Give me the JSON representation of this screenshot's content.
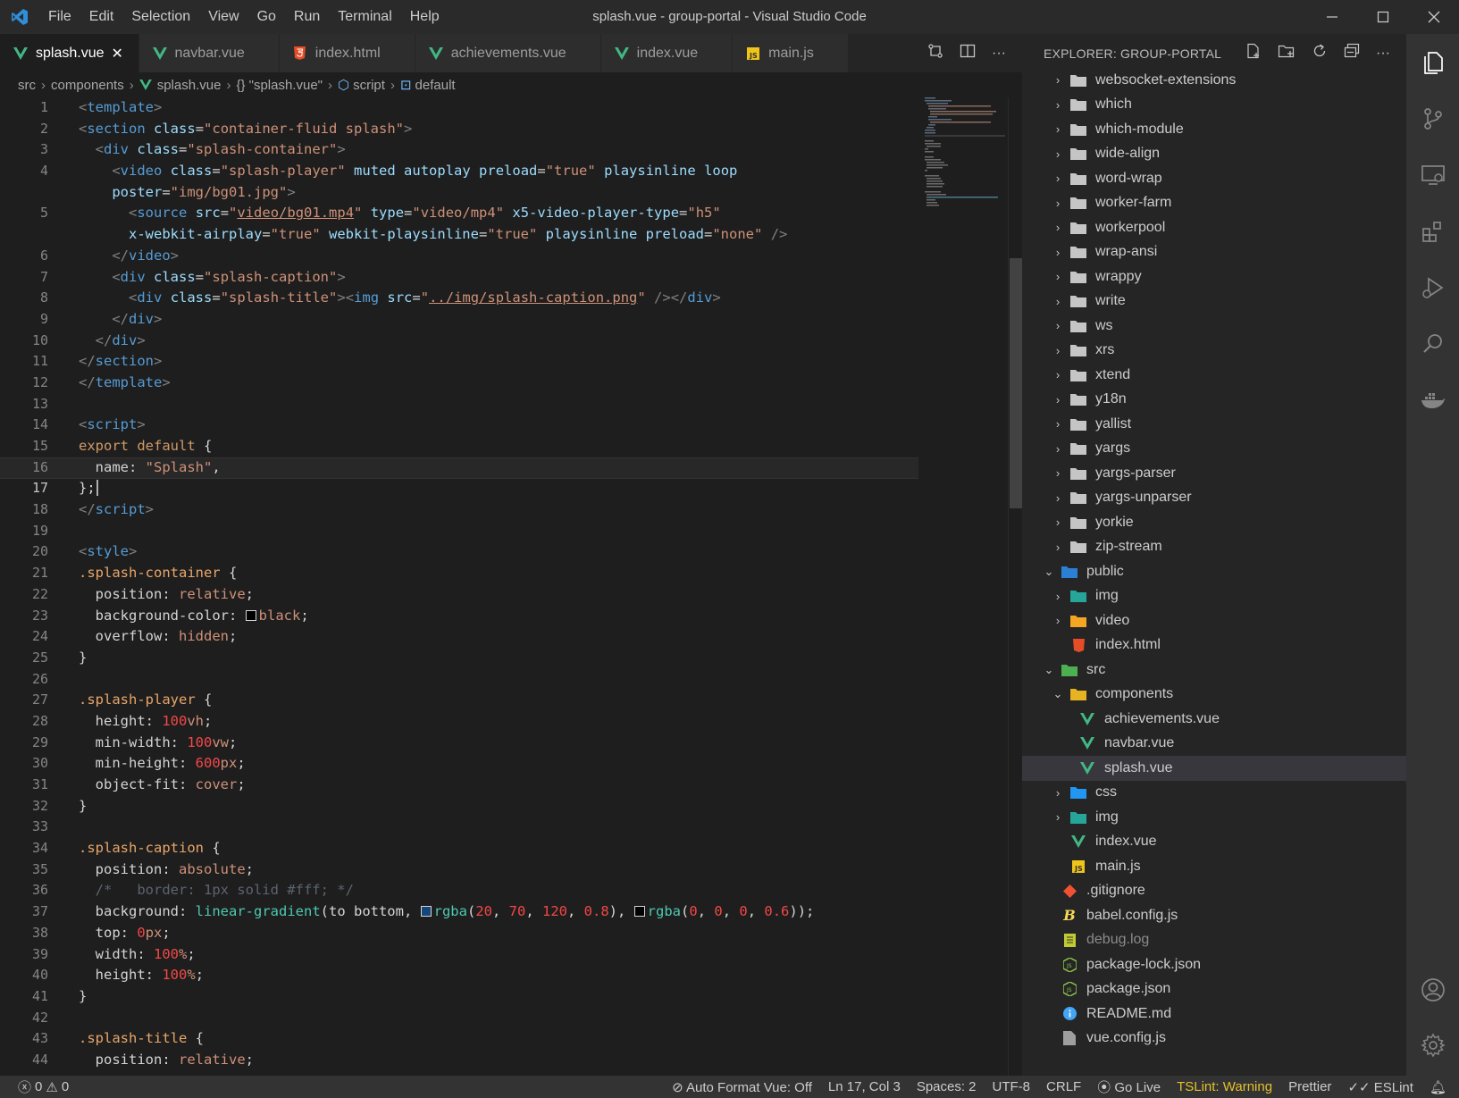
{
  "app": {
    "window_title": "splash.vue - group-portal - Visual Studio Code",
    "menus": [
      "File",
      "Edit",
      "Selection",
      "View",
      "Go",
      "Run",
      "Terminal",
      "Help"
    ]
  },
  "tabs": [
    {
      "label": "splash.vue",
      "icon": "vue-icon",
      "active": true
    },
    {
      "label": "navbar.vue",
      "icon": "vue-icon",
      "active": false
    },
    {
      "label": "index.html",
      "icon": "html-icon",
      "active": false
    },
    {
      "label": "achievements.vue",
      "icon": "vue-icon",
      "active": false
    },
    {
      "label": "index.vue",
      "icon": "vue-icon",
      "active": false
    },
    {
      "label": "main.js",
      "icon": "js-icon",
      "active": false
    }
  ],
  "breadcrumb": [
    "src",
    "components",
    "splash.vue",
    "{} \"splash.vue\"",
    "script",
    "default"
  ],
  "editor": {
    "current_line": 17,
    "line_numbers": [
      "1",
      "2",
      "3",
      "4",
      "",
      "5",
      "",
      "6",
      "7",
      "8",
      "9",
      "10",
      "11",
      "12",
      "13",
      "14",
      "15",
      "16",
      "17",
      "18",
      "19",
      "20",
      "21",
      "22",
      "23",
      "24",
      "25",
      "26",
      "27",
      "28",
      "29",
      "30",
      "31",
      "32",
      "33",
      "34",
      "35",
      "36",
      "37",
      "38",
      "39",
      "40",
      "41",
      "42",
      "43",
      "44"
    ]
  },
  "explorer": {
    "title": "EXPLORER: GROUP-PORTAL",
    "items": [
      {
        "label": "websocket-extensions",
        "type": "folder",
        "depth": 1,
        "open": false
      },
      {
        "label": "which",
        "type": "folder",
        "depth": 1,
        "open": false
      },
      {
        "label": "which-module",
        "type": "folder",
        "depth": 1,
        "open": false
      },
      {
        "label": "wide-align",
        "type": "folder",
        "depth": 1,
        "open": false
      },
      {
        "label": "word-wrap",
        "type": "folder",
        "depth": 1,
        "open": false
      },
      {
        "label": "worker-farm",
        "type": "folder",
        "depth": 1,
        "open": false
      },
      {
        "label": "workerpool",
        "type": "folder",
        "depth": 1,
        "open": false
      },
      {
        "label": "wrap-ansi",
        "type": "folder",
        "depth": 1,
        "open": false
      },
      {
        "label": "wrappy",
        "type": "folder",
        "depth": 1,
        "open": false
      },
      {
        "label": "write",
        "type": "folder",
        "depth": 1,
        "open": false
      },
      {
        "label": "ws",
        "type": "folder",
        "depth": 1,
        "open": false
      },
      {
        "label": "xrs",
        "type": "folder",
        "depth": 1,
        "open": false
      },
      {
        "label": "xtend",
        "type": "folder",
        "depth": 1,
        "open": false
      },
      {
        "label": "y18n",
        "type": "folder",
        "depth": 1,
        "open": false
      },
      {
        "label": "yallist",
        "type": "folder",
        "depth": 1,
        "open": false
      },
      {
        "label": "yargs",
        "type": "folder",
        "depth": 1,
        "open": false
      },
      {
        "label": "yargs-parser",
        "type": "folder",
        "depth": 1,
        "open": false
      },
      {
        "label": "yargs-unparser",
        "type": "folder",
        "depth": 1,
        "open": false
      },
      {
        "label": "yorkie",
        "type": "folder",
        "depth": 1,
        "open": false
      },
      {
        "label": "zip-stream",
        "type": "folder",
        "depth": 1,
        "open": false
      },
      {
        "label": "public",
        "type": "folder-public",
        "depth": 0,
        "open": true
      },
      {
        "label": "img",
        "type": "folder-img",
        "depth": 1,
        "open": false
      },
      {
        "label": "video",
        "type": "folder-video",
        "depth": 1,
        "open": false
      },
      {
        "label": "index.html",
        "type": "html",
        "depth": 1
      },
      {
        "label": "src",
        "type": "folder-src",
        "depth": 0,
        "open": true
      },
      {
        "label": "components",
        "type": "folder-components",
        "depth": 1,
        "open": true
      },
      {
        "label": "achievements.vue",
        "type": "vue",
        "depth": 2
      },
      {
        "label": "navbar.vue",
        "type": "vue",
        "depth": 2
      },
      {
        "label": "splash.vue",
        "type": "vue",
        "depth": 2,
        "selected": true
      },
      {
        "label": "css",
        "type": "folder-css",
        "depth": 1,
        "open": false
      },
      {
        "label": "img",
        "type": "folder-img",
        "depth": 1,
        "open": false
      },
      {
        "label": "index.vue",
        "type": "vue",
        "depth": 1
      },
      {
        "label": "main.js",
        "type": "js",
        "depth": 1
      },
      {
        "label": ".gitignore",
        "type": "git",
        "depth": 0
      },
      {
        "label": "babel.config.js",
        "type": "babel",
        "depth": 0
      },
      {
        "label": "debug.log",
        "type": "log",
        "depth": 0,
        "dim": true
      },
      {
        "label": "package-lock.json",
        "type": "node",
        "depth": 0
      },
      {
        "label": "package.json",
        "type": "node",
        "depth": 0
      },
      {
        "label": "README.md",
        "type": "info",
        "depth": 0
      },
      {
        "label": "vue.config.js",
        "type": "config",
        "depth": 0
      }
    ]
  },
  "statusbar": {
    "errors": "0",
    "warnings": "0",
    "auto_format": "Auto Format Vue: Off",
    "position": "Ln 17, Col 3",
    "spaces": "Spaces: 2",
    "encoding": "UTF-8",
    "eol": "CRLF",
    "go_live": "Go Live",
    "tslint": "TSLint: Warning",
    "prettier": "Prettier",
    "eslint": "ESLint"
  },
  "colors": {
    "accent_vue": "#41b883",
    "html": "#e44d26",
    "js": "#f0c419",
    "warning": "#e5c02b"
  }
}
